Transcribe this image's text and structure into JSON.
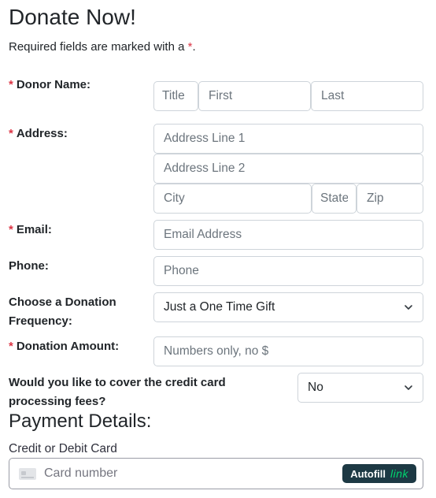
{
  "header": {
    "title": "Donate Now!",
    "required_note_prefix": "Required fields are marked with a ",
    "required_marker": "*",
    "required_note_suffix": "."
  },
  "donor_name": {
    "label": "Donor Name:",
    "required": true,
    "title_placeholder": "Title",
    "first_placeholder": "First",
    "last_placeholder": "Last"
  },
  "address": {
    "label": "Address:",
    "required": true,
    "line1_placeholder": "Address Line 1",
    "line2_placeholder": "Address Line 2",
    "city_placeholder": "City",
    "state_placeholder": "State",
    "zip_placeholder": "Zip"
  },
  "email": {
    "label": "Email:",
    "required": true,
    "placeholder": "Email Address"
  },
  "phone": {
    "label": "Phone:",
    "required": false,
    "placeholder": "Phone"
  },
  "frequency": {
    "label_line1": "Choose a Donation",
    "label_line2": "Frequency:",
    "selected": "Just a One Time Gift"
  },
  "amount": {
    "label": "Donation Amount:",
    "required": true,
    "placeholder": "Numbers only, no $"
  },
  "cover_fees": {
    "label_line1": "Would you like to cover the credit card",
    "label_line2": "processing fees?",
    "selected": "No"
  },
  "payment": {
    "title": "Payment Details:",
    "card_label": "Credit or Debit Card",
    "card_placeholder": "Card number",
    "autofill_label": "Autofill",
    "link_label": "link"
  },
  "colors": {
    "required": "#dc3545",
    "border": "#ced4da",
    "autofill_bg": "#1d3944",
    "link_green": "#00d66f"
  }
}
